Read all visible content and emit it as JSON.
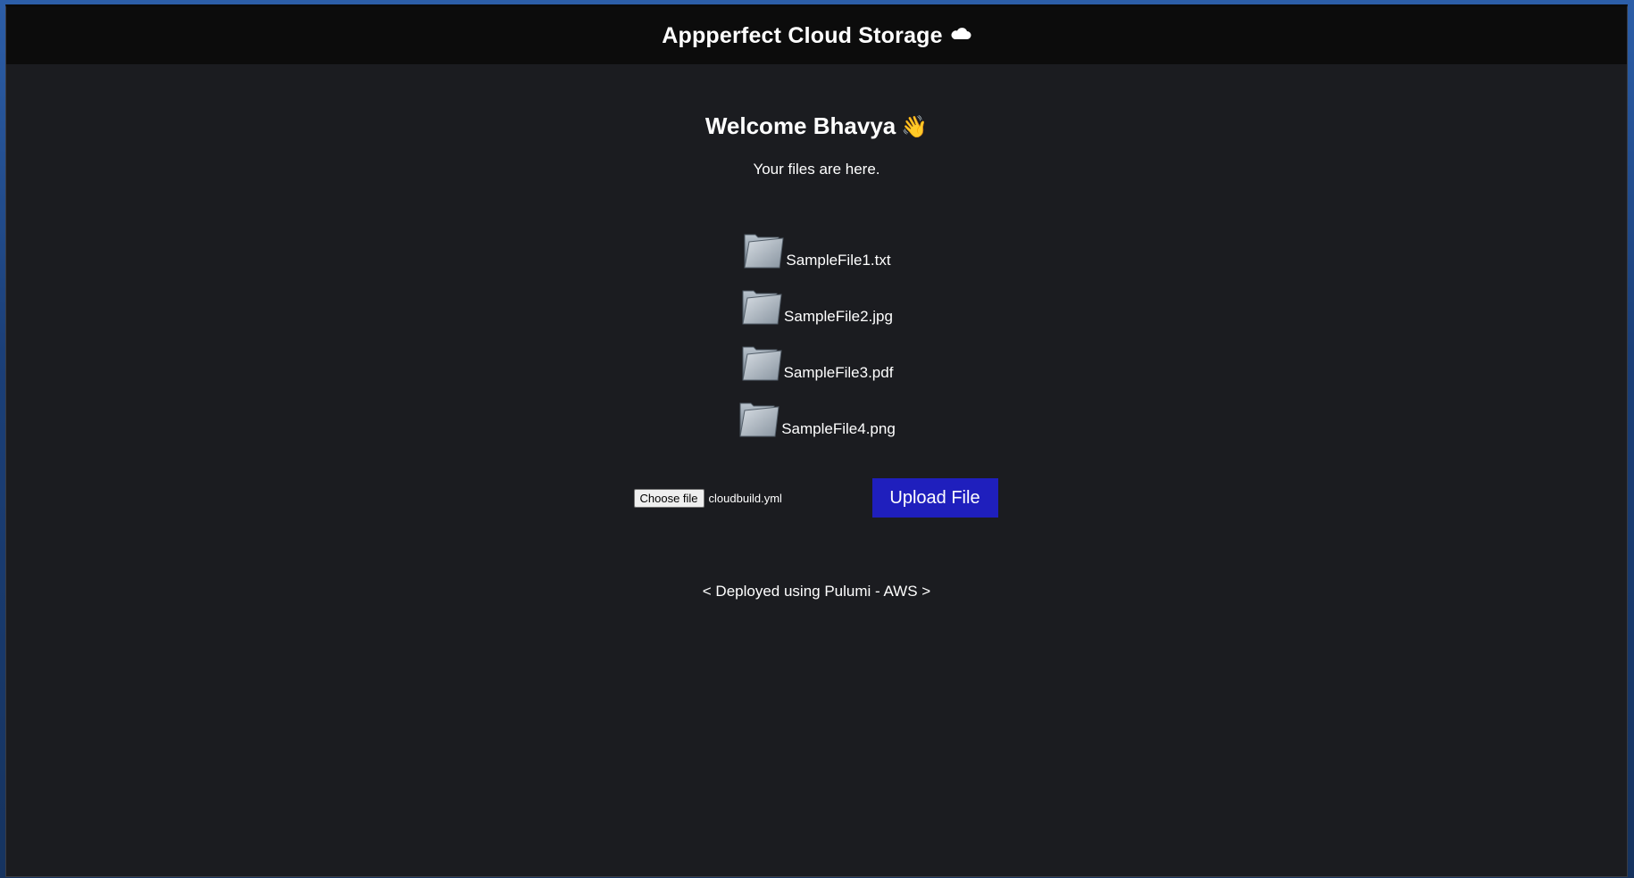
{
  "header": {
    "title": "Appperfect Cloud Storage",
    "title_icon": "cloud-icon"
  },
  "main": {
    "welcome": "Welcome Bhavya",
    "welcome_icon": "waving-hand-icon",
    "welcome_emoji": "👋",
    "subtitle": "Your files are here.",
    "files": [
      {
        "name": "SampleFile1.txt",
        "icon": "folder-icon"
      },
      {
        "name": "SampleFile2.jpg",
        "icon": "folder-icon"
      },
      {
        "name": "SampleFile3.pdf",
        "icon": "folder-icon"
      },
      {
        "name": "SampleFile4.png",
        "icon": "folder-icon"
      }
    ]
  },
  "upload": {
    "choose_label": "Choose file",
    "selected_file": "cloudbuild.yml",
    "upload_label": "Upload File",
    "upload_color": "#1f1fbd"
  },
  "footer": {
    "note": "< Deployed using Pulumi - AWS >"
  },
  "colors": {
    "page_bg": "#1b1c20",
    "topbar_bg": "#0c0c0c",
    "text": "#ffffff"
  }
}
